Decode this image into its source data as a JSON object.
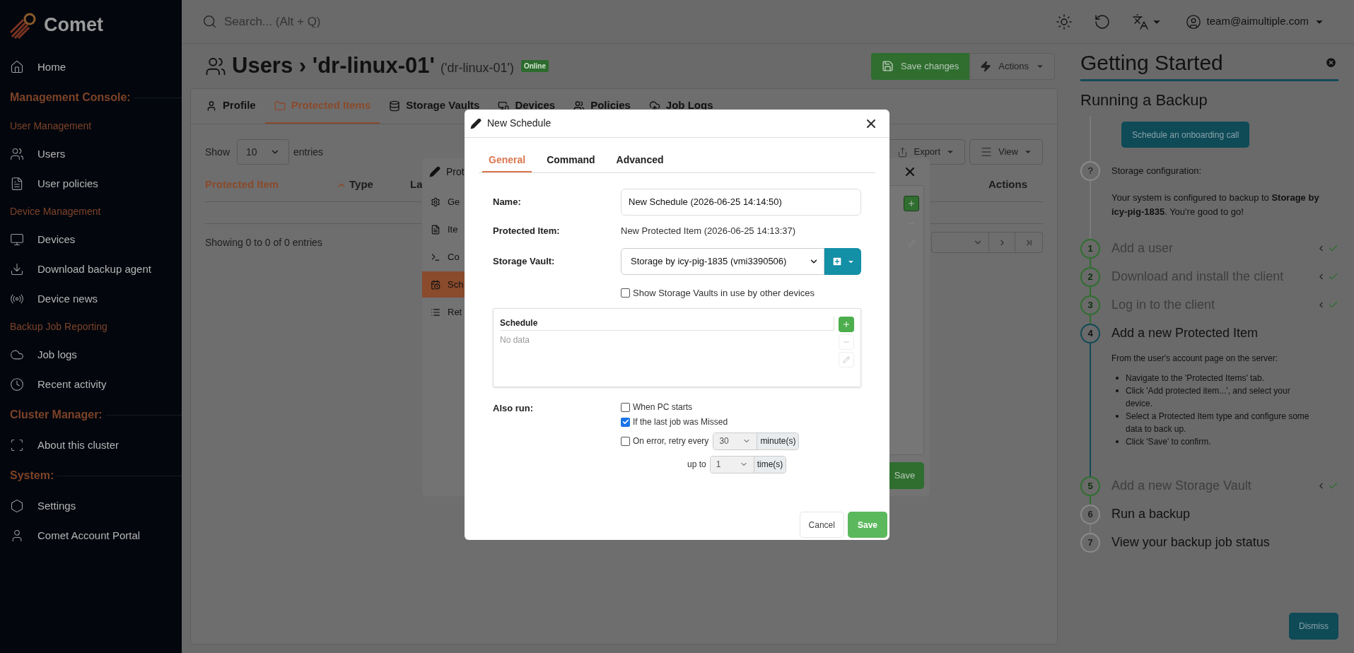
{
  "sidebar": {
    "logo": "Comet",
    "items": [
      {
        "kind": "link",
        "label": "Home"
      },
      {
        "kind": "heading",
        "label": "Management Console:"
      },
      {
        "kind": "subheading",
        "label": "User Management"
      },
      {
        "kind": "link",
        "label": "Users"
      },
      {
        "kind": "link",
        "label": "User policies"
      },
      {
        "kind": "subheading",
        "label": "Device Management"
      },
      {
        "kind": "link",
        "label": "Devices"
      },
      {
        "kind": "link",
        "label": "Download backup agent"
      },
      {
        "kind": "link",
        "label": "Device news"
      },
      {
        "kind": "subheading",
        "label": "Backup Job Reporting"
      },
      {
        "kind": "link",
        "label": "Job logs"
      },
      {
        "kind": "link",
        "label": "Recent activity"
      },
      {
        "kind": "heading",
        "label": "Cluster Manager:"
      },
      {
        "kind": "link",
        "label": "About this cluster"
      },
      {
        "kind": "heading",
        "label": "System:"
      },
      {
        "kind": "link",
        "label": "Settings"
      },
      {
        "kind": "link",
        "label": "Comet Account Portal"
      }
    ]
  },
  "topbar": {
    "search": {
      "placeholder": "Search... (Alt + Q)"
    },
    "account": "team@aimultiple.com"
  },
  "page": {
    "breadcrumb": "Users",
    "separator": "›",
    "title": "'dr-linux-01'",
    "subtitle": "('dr-linux-01')",
    "status": "Online",
    "save_button": "Save changes",
    "actions_button": "Actions",
    "tabs": [
      {
        "label": "Profile",
        "selected": false
      },
      {
        "label": "Protected Items",
        "selected": true
      },
      {
        "label": "Storage Vaults",
        "selected": false
      },
      {
        "label": "Devices",
        "selected": false
      },
      {
        "label": "Policies",
        "selected": false
      },
      {
        "label": "Job Logs",
        "selected": false
      }
    ],
    "table": {
      "show": "Show",
      "page_size": "10",
      "entries": "entries",
      "columns": [
        "Protected Item",
        "Type",
        "La",
        "Actions"
      ],
      "info": "Showing 0 to 0 of 0 entries",
      "export": "Export",
      "view": "View"
    }
  },
  "back_dialog": {
    "title": "Prot",
    "menu": [
      {
        "label": "Ge",
        "selected": false
      },
      {
        "label": "Ite",
        "selected": false
      },
      {
        "label": "Co",
        "selected": false
      },
      {
        "label": "Sch",
        "selected": true
      },
      {
        "label": "Ret",
        "selected": false
      }
    ],
    "save": "Save"
  },
  "modal": {
    "title": "New Schedule",
    "tabs": [
      {
        "label": "General",
        "selected": true
      },
      {
        "label": "Command",
        "selected": false
      },
      {
        "label": "Advanced",
        "selected": false
      }
    ],
    "name_label": "Name:",
    "name_value": "New Schedule (2026-06-25 14:14:50)",
    "item_label": "Protected Item:",
    "item_value": "New Protected Item (2026-06-25 14:13:37)",
    "vault_label": "Storage Vault:",
    "vault_value": "Storage by icy-pig-1835 (vmi3390506)",
    "show_vaults": {
      "label": "Show Storage Vaults in use by other devices",
      "checked": false
    },
    "schedule": {
      "heading": "Schedule",
      "empty": "No data"
    },
    "also_run": {
      "label": "Also run:",
      "options": [
        {
          "label": "When PC starts",
          "checked": false
        },
        {
          "label": "If the last job was Missed",
          "checked": true
        },
        {
          "label": "On error, retry every",
          "checked": false
        }
      ],
      "retry_interval": "30",
      "interval_unit": "minute(s)",
      "up_to": "up to",
      "retry_count": "1",
      "count_unit": "time(s)"
    },
    "cancel": "Cancel",
    "save": "Save"
  },
  "getting_started": {
    "title": "Getting Started",
    "subtitle": "Running a Backup",
    "onboarding_button": "Schedule an onboarding call",
    "config": {
      "marker": "?",
      "title": "Storage configuration:",
      "text": "Your system is configured to backup to **Storage by icy-pig-1835**. You're good to go!"
    },
    "steps": [
      {
        "number": "1",
        "title": "Add a user",
        "completed": true,
        "active": false
      },
      {
        "number": "2",
        "title": "Download and install the client",
        "completed": true,
        "active": false
      },
      {
        "number": "3",
        "title": "Log in to the client",
        "completed": true,
        "active": false
      },
      {
        "number": "4",
        "title": "Add a new Protected Item",
        "completed": false,
        "active": true,
        "intro": "From the user's account page on the server:",
        "bullets": [
          "Navigate to the 'Protected Items' tab.",
          "Click 'Add protected item...', and select your device.",
          "Select a Protected Item type and configure some data to back up.",
          "Click 'Save' to confirm."
        ]
      },
      {
        "number": "5",
        "title": "Add a new Storage Vault",
        "completed": true,
        "active": false
      },
      {
        "number": "6",
        "title": "Run a backup",
        "completed": false,
        "active": false
      },
      {
        "number": "7",
        "title": "View your backup job status",
        "completed": false,
        "active": false
      }
    ],
    "dismiss": "Dismiss"
  }
}
